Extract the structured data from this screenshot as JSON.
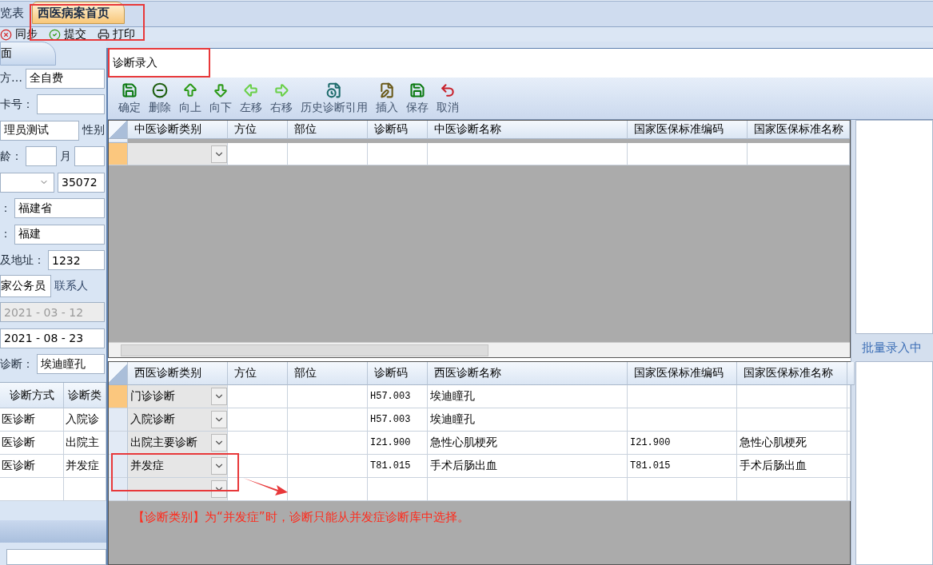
{
  "top_tabs": [
    {
      "label": "览表",
      "selected": false
    },
    {
      "label": "西医病案首页",
      "selected": true
    }
  ],
  "toolbar": [
    "同步",
    "提交",
    "打印"
  ],
  "left_panel": {
    "tab": "面",
    "rows": [
      [
        {
          "kind": "label",
          "text": "方…"
        },
        {
          "kind": "field",
          "value": "全自费"
        }
      ],
      [
        {
          "kind": "label",
          "text": "卡号："
        },
        {
          "kind": "field"
        }
      ],
      [
        {
          "kind": "field",
          "value": "理员测试"
        },
        {
          "kind": "label",
          "text": "性别"
        }
      ],
      [
        {
          "kind": "label",
          "text": "龄："
        },
        {
          "kind": "field"
        },
        {
          "kind": "label",
          "text": "月"
        },
        {
          "kind": "field"
        }
      ],
      [
        {
          "kind": "combo"
        },
        {
          "kind": "field",
          "value": "35072"
        }
      ],
      [
        {
          "kind": "label",
          "text": "："
        },
        {
          "kind": "field",
          "value": "福建省"
        }
      ],
      [
        {
          "kind": "label",
          "text": "："
        },
        {
          "kind": "field",
          "value": "福建"
        }
      ],
      [
        {
          "kind": "label",
          "text": "及地址："
        },
        {
          "kind": "field",
          "value": "1232"
        }
      ],
      [
        {
          "kind": "tab",
          "text": "家公务员",
          "selected": true
        },
        {
          "kind": "tab",
          "text": "联系人",
          "selected": false
        }
      ],
      [
        {
          "kind": "field",
          "value": "2021 - 03 - 12",
          "disabled": true
        }
      ],
      [
        {
          "kind": "field",
          "value": "2021 - 08 - 23",
          "disabled": false
        }
      ],
      [
        {
          "kind": "label",
          "text": "诊断："
        },
        {
          "kind": "field",
          "value": "埃迪瞳孔"
        }
      ]
    ],
    "table": {
      "columns": [
        "诊断方式",
        "诊断类"
      ],
      "rows": [
        [
          "医诊断",
          "入院诊"
        ],
        [
          "医诊断",
          "出院主"
        ],
        [
          "医诊断",
          "并发症"
        ]
      ]
    }
  },
  "dialog": {
    "title": "诊断录入",
    "toolbar": [
      "确定",
      "删除",
      "向上",
      "向下",
      "左移",
      "右移",
      "历史诊断引用",
      "插入",
      "保存",
      "取消"
    ],
    "tcm_grid": {
      "columns": [
        "中医诊断类别",
        "方位",
        "部位",
        "诊断码",
        "中医诊断名称",
        "国家医保标准编码",
        "国家医保标准名称"
      ],
      "rows": [
        {
          "selected": true
        }
      ]
    },
    "wm_grid": {
      "columns": [
        "西医诊断类别",
        "方位",
        "部位",
        "诊断码",
        "西医诊断名称",
        "国家医保标准编码",
        "国家医保标准名称"
      ],
      "rows": [
        {
          "selected": true,
          "category": "门诊诊断",
          "code": "H57.003",
          "name": "埃迪瞳孔"
        },
        {
          "selected": false,
          "category": "入院诊断",
          "code": "H57.003",
          "name": "埃迪瞳孔"
        },
        {
          "selected": false,
          "category": "出院主要诊断",
          "code": "I21.900",
          "name": "急性心肌梗死",
          "std_code": "I21.900",
          "std_name": "急性心肌梗死"
        },
        {
          "selected": false,
          "category": "并发症",
          "code": "T81.015",
          "name": "手术后肠出血",
          "std_code": "T81.015",
          "std_name": "手术后肠出血"
        },
        {
          "selected": false
        }
      ]
    },
    "side_label": "批量录入中"
  },
  "annotation": "【诊断类别】为“并发症”时，诊断只能从并发症诊断库中选择。"
}
